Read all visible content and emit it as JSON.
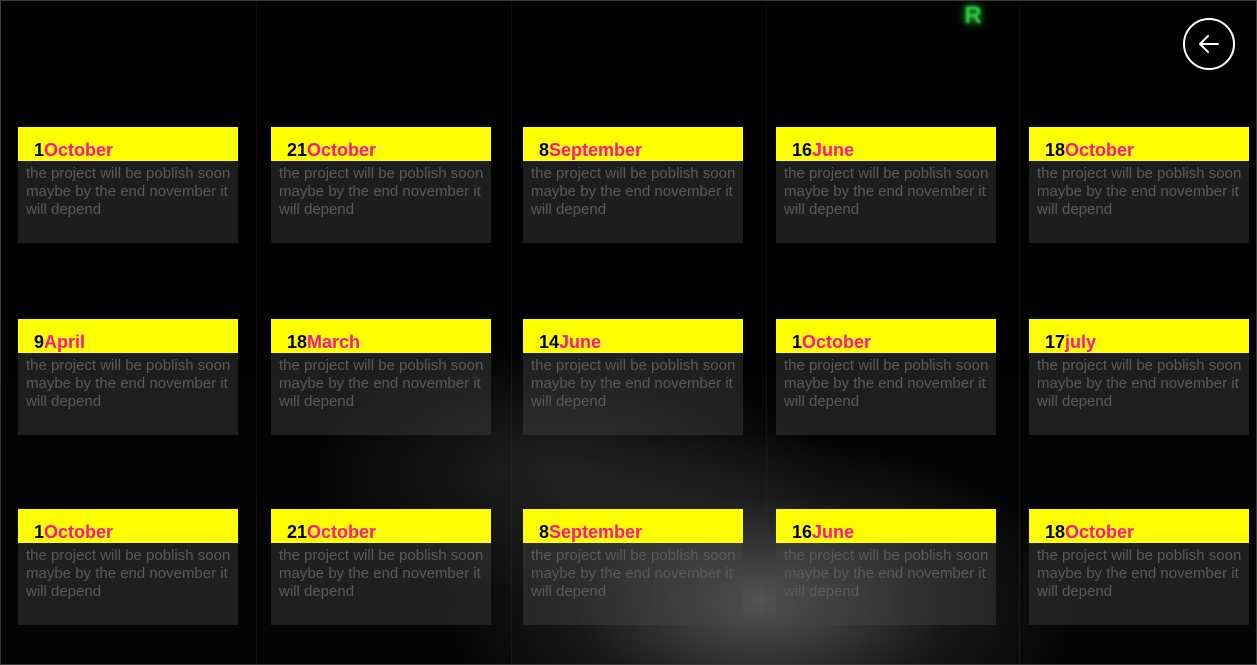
{
  "logo": {
    "text": "R"
  },
  "back_button": {
    "icon": "arrow-left-icon"
  },
  "colors": {
    "header_bg": "#ffff00",
    "day_color": "#000000",
    "month_color": "#ff1493",
    "body_text": "#5a5a5a",
    "logo": "#2ecc40"
  },
  "cards": [
    {
      "day": "1",
      "month": "October",
      "text": "the project will be poblish soon maybe by the end november it will depend"
    },
    {
      "day": "21",
      "month": "October",
      "text": "the project will be poblish soon maybe by the end november it will depend"
    },
    {
      "day": "8",
      "month": "September",
      "text": "the project will be poblish soon maybe by the end november it will depend"
    },
    {
      "day": "16",
      "month": "June",
      "text": "the project will be poblish soon maybe by the end november it will depend"
    },
    {
      "day": "18",
      "month": "October",
      "text": "the project will be poblish soon maybe by the end november it will depend"
    },
    {
      "day": "9",
      "month": "April",
      "text": "the project will be poblish soon maybe by the end november it will depend"
    },
    {
      "day": "18",
      "month": "March",
      "text": "the project will be poblish soon maybe by the end november it will depend"
    },
    {
      "day": "14",
      "month": "June",
      "text": "the project will be poblish soon maybe by the end november it will depend"
    },
    {
      "day": "1",
      "month": "October",
      "text": "the project will be poblish soon maybe by the end november it will depend"
    },
    {
      "day": "17",
      "month": "july",
      "text": "the project will be poblish soon maybe by the end november it will depend"
    },
    {
      "day": "1",
      "month": "October",
      "text": "the project will be poblish soon maybe by the end november it will depend"
    },
    {
      "day": "21",
      "month": "October",
      "text": "the project will be poblish soon maybe by the end november it will depend"
    },
    {
      "day": "8",
      "month": "September",
      "text": "the project will be poblish soon maybe by the end november it will depend"
    },
    {
      "day": "16",
      "month": "June",
      "text": "the project will be poblish soon maybe by the end november it will depend"
    },
    {
      "day": "18",
      "month": "October",
      "text": "the project will be poblish soon maybe by the end november it will depend"
    }
  ]
}
